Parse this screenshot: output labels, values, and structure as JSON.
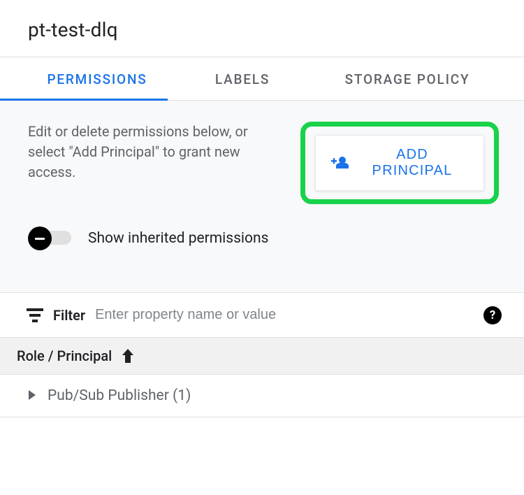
{
  "header": {
    "title": "pt-test-dlq"
  },
  "tabs": [
    {
      "label": "PERMISSIONS",
      "active": true
    },
    {
      "label": "LABELS",
      "active": false
    },
    {
      "label": "STORAGE POLICY",
      "active": false
    }
  ],
  "permissions": {
    "hint": "Edit or delete permissions below, or select \"Add Principal\" to grant new access.",
    "add_button_label": "ADD PRINCIPAL",
    "toggle": {
      "label": "Show inherited permissions",
      "state": "off"
    }
  },
  "filter": {
    "label": "Filter",
    "placeholder": "Enter property name or value"
  },
  "table": {
    "header": "Role / Principal",
    "sort_dir": "asc",
    "rows": [
      {
        "name": "Pub/Sub Publisher (1)",
        "expanded": false
      }
    ]
  }
}
